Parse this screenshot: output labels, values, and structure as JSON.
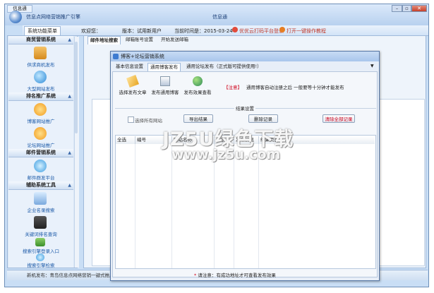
{
  "window": {
    "icon_label": "信息通",
    "title": "信息点网络营销推广引擎",
    "center_title": "信息通"
  },
  "menu": {
    "tab_main": "系统功能菜单",
    "welcome": "欢迎您：",
    "version": "版本：试用新用户",
    "date_label": "当前时间是：2015-03-24",
    "link1": "优优云打码平台登录",
    "link2": "打开一键操作教程"
  },
  "sidebar": {
    "sections": [
      {
        "title": "商贸营销系统",
        "items": [
          "供求商机发布",
          "大型网站发布"
        ]
      },
      {
        "title": "排名推广系统",
        "items": [
          "博客网站推广",
          "论坛网站推广"
        ]
      },
      {
        "title": "邮件营销系统",
        "items": [
          "邮件群发平台"
        ]
      },
      {
        "title": "辅助系统工具",
        "items": [
          "企业名录搜索",
          "关键词排名查询",
          "搜索引擎登录入口",
          "搜索引擎检索"
        ]
      }
    ]
  },
  "content_tabs": [
    "邮件地址搜索",
    "邮箱账号设置",
    "开始发送邮箱"
  ],
  "dialog": {
    "title": "博客+论坛营销系统",
    "tabs": [
      "基本信息设置",
      "通用博客发布",
      "通用论坛发布（正式版可提供使用!）"
    ],
    "toolbar": [
      "选择发布文章",
      "发布通用博客",
      "发布效果查看"
    ],
    "notice_tag": "【注意】",
    "notice_text": "通用博客自动注册之后 一般要等十分钟才能发布",
    "group_label": "结果设置",
    "checkbox_label": "选择所有网站",
    "btn_export": "导出结果",
    "btn_delete": "删除记录",
    "btn_clear": "清除全部记录",
    "columns": [
      "全选",
      "编号",
      "网站名称",
      "注册",
      "发布信息",
      "结果页面"
    ],
    "footer_note": "请注意：有成功地址才可查看发布效果"
  },
  "status": {
    "text": "新机发布：青岛信息点网络营销一键式推广"
  },
  "watermark": {
    "line1": "JZ5U绿色下载",
    "line2": "www.jz5u.com"
  },
  "colors": {
    "accent": "#2e63b5",
    "notice": "#d0021b",
    "title_bg": "#b8d1ef"
  },
  "icons": [
    "app-logo-icon",
    "minimize-icon",
    "restore-icon",
    "close-icon",
    "publish-icon",
    "globe-icon",
    "blog-icon",
    "forum-icon",
    "mail-icon",
    "search-icon",
    "keyword-icon",
    "login-icon",
    "engine-icon"
  ]
}
